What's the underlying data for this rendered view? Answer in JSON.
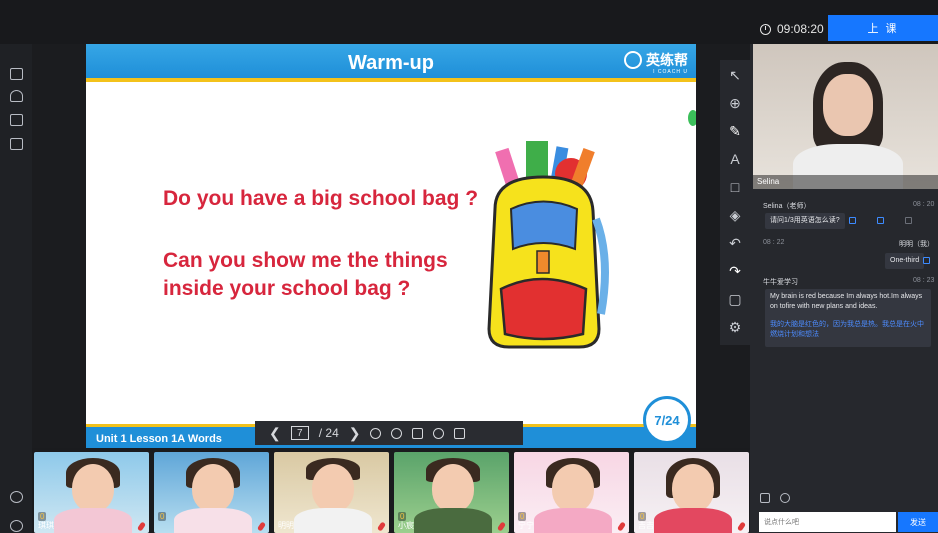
{
  "header": {
    "timer": "09:08:20",
    "start_label": "上 课"
  },
  "slide": {
    "title": "Warm-up",
    "brand_name": "英练帮",
    "brand_sub": "I COACH U",
    "question1": "Do you have a big school bag ?",
    "question2": "Can you show me the things inside your school bag ?",
    "unit": "Unit 1 Lesson 1A Words",
    "page_badge": "7/24"
  },
  "pager": {
    "current": "7",
    "total": "/ 24"
  },
  "teacher": {
    "name": "Selina"
  },
  "chat": {
    "messages": [
      {
        "sender": "Selina（老师）",
        "time": "08 : 20",
        "text": "请问1/3用英语怎么读?"
      },
      {
        "sender": "明明（我）",
        "time": "08 : 22",
        "text": "One-third"
      },
      {
        "sender": "牛牛爱学习",
        "time": "08 : 23",
        "text": "My brain is red because Im always hot.Im always on tofire with new plans and ideas.",
        "translation": "我的大脑是红色的，因为我总是热。我总是在火中燃烧计划和想法"
      }
    ],
    "input_placeholder": "说点什么吧",
    "send_label": "发送"
  },
  "students": [
    {
      "name": "琪琪",
      "score": "0"
    },
    {
      "name": "",
      "score": "0"
    },
    {
      "name": "明明",
      "score": ""
    },
    {
      "name": "小宸",
      "score": "0"
    },
    {
      "name": "宁宁",
      "score": "0"
    },
    {
      "name": "吉吉",
      "score": "0"
    }
  ],
  "colors": {
    "accent": "#1677ff",
    "slide_blue": "#1f8fd8",
    "question_red": "#d7263d"
  }
}
